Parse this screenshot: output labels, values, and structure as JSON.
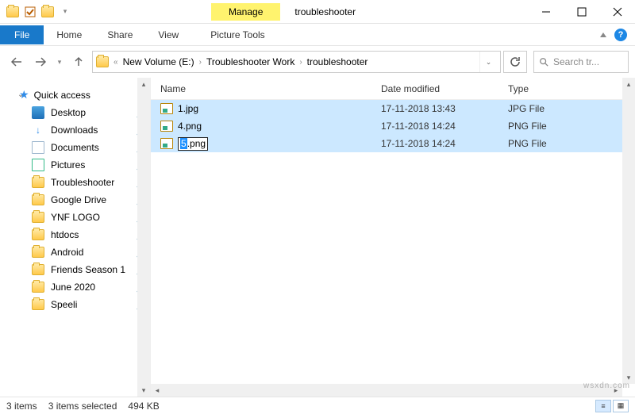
{
  "title": "troubleshooter",
  "contextual_tab": "Manage",
  "picture_tools": "Picture Tools",
  "ribbon": {
    "file": "File",
    "home": "Home",
    "share": "Share",
    "view": "View"
  },
  "breadcrumbs": {
    "prefix": "«",
    "c0": "New Volume (E:)",
    "c1": "Troubleshooter Work",
    "c2": "troubleshooter"
  },
  "search_placeholder": "Search tr...",
  "sidebar": {
    "quick_access": "Quick access",
    "items": [
      {
        "label": "Desktop"
      },
      {
        "label": "Downloads"
      },
      {
        "label": "Documents"
      },
      {
        "label": "Pictures"
      },
      {
        "label": "Troubleshooter"
      },
      {
        "label": "Google Drive"
      },
      {
        "label": "YNF LOGO"
      },
      {
        "label": "htdocs"
      },
      {
        "label": "Android"
      },
      {
        "label": "Friends Season 1"
      },
      {
        "label": "June 2020"
      },
      {
        "label": "Speeli"
      }
    ]
  },
  "columns": {
    "name": "Name",
    "date": "Date modified",
    "type": "Type"
  },
  "files": [
    {
      "name": "1.jpg",
      "date": "17-11-2018 13:43",
      "type": "JPG File"
    },
    {
      "name": "4.png",
      "date": "17-11-2018 14:24",
      "type": "PNG File"
    },
    {
      "name": "5",
      "ext": ".png",
      "date": "17-11-2018 14:24",
      "type": "PNG File"
    }
  ],
  "status": {
    "count": "3 items",
    "selected": "3 items selected",
    "size": "494 KB"
  },
  "watermark": "wsxdn.com"
}
